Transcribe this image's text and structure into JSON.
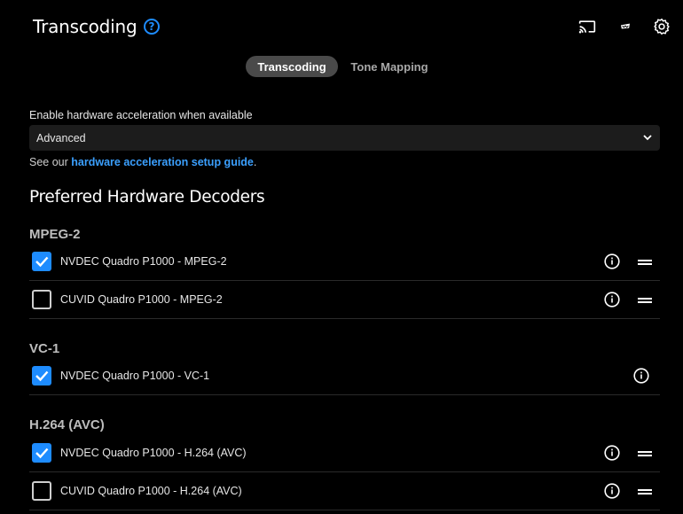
{
  "header": {
    "title": "Transcoding",
    "help_icon": "help-circle-icon",
    "actions": [
      "cast-icon",
      "jellyfin-logo-icon",
      "gear-icon"
    ]
  },
  "tabs": [
    {
      "label": "Transcoding",
      "active": true
    },
    {
      "label": "Tone Mapping",
      "active": false
    }
  ],
  "hwaccel": {
    "label": "Enable hardware acceleration when available",
    "selected": "Advanced",
    "guide_prefix": "See our ",
    "guide_link": "hardware acceleration setup guide",
    "guide_suffix": "."
  },
  "section_title": "Preferred Hardware Decoders",
  "groups": [
    {
      "title": "MPEG-2",
      "items": [
        {
          "label": "NVDEC Quadro P1000 - MPEG-2",
          "checked": true
        },
        {
          "label": "CUVID Quadro P1000 - MPEG-2",
          "checked": false
        }
      ]
    },
    {
      "title": "VC-1",
      "items": [
        {
          "label": "NVDEC Quadro P1000 - VC-1",
          "checked": true
        }
      ]
    },
    {
      "title": "H.264 (AVC)",
      "items": [
        {
          "label": "NVDEC Quadro P1000 - H.264 (AVC)",
          "checked": true
        },
        {
          "label": "CUVID Quadro P1000 - H.264 (AVC)",
          "checked": false
        }
      ]
    }
  ],
  "colors": {
    "accent": "#1e8cff",
    "background": "#000000",
    "active_tab": "#4a4a4a"
  }
}
